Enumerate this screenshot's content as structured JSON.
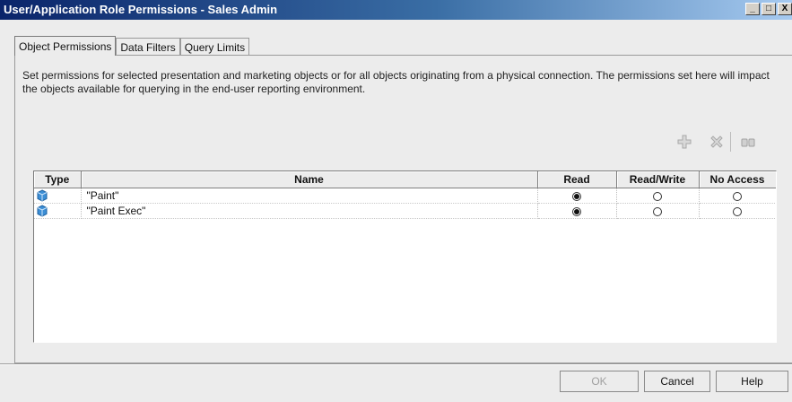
{
  "window": {
    "title": "User/Application Role Permissions - Sales Admin",
    "controls": {
      "minimize": "_",
      "maximize": "□",
      "close": "X"
    }
  },
  "tabs": [
    {
      "label": "Object Permissions",
      "active": true
    },
    {
      "label": "Data Filters",
      "active": false
    },
    {
      "label": "Query Limits",
      "active": false
    }
  ],
  "description": "Set permissions for selected presentation and marketing objects or for all objects originating from a physical connection. The permissions set here will impact the objects available for querying in the end-user reporting environment.",
  "toolbar": {
    "add_icon": "plus-icon",
    "delete_icon": "delete-x-icon",
    "browse_icon": "binoculars-icon"
  },
  "grid": {
    "columns": [
      "Type",
      "Name",
      "Read",
      "Read/Write",
      "No Access"
    ],
    "rows": [
      {
        "icon": "cube-icon",
        "name": "\"Paint\"",
        "permission": "Read"
      },
      {
        "icon": "cube-icon",
        "name": "\"Paint Exec\"",
        "permission": "Read"
      }
    ]
  },
  "buttons": {
    "ok": "OK",
    "cancel": "Cancel",
    "help": "Help"
  }
}
